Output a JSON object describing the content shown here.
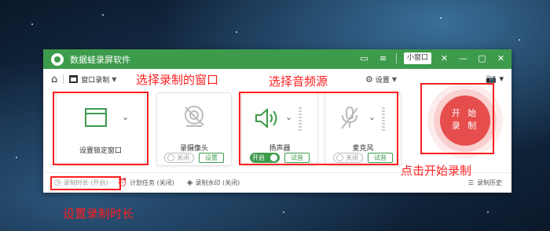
{
  "app": {
    "title": "数据蛙录屏软件",
    "mini_window": "小窗口",
    "icons": [
      "chat-icon",
      "mini-window-button",
      "pin-icon",
      "minimize-icon",
      "maximize-icon",
      "close-icon"
    ]
  },
  "toolbar": {
    "mode_label": "窗口录制",
    "settings_label": "设置"
  },
  "cards": {
    "window": {
      "label": "设置锁定窗口"
    },
    "camera": {
      "label": "录摄像头",
      "toggle": "关闭",
      "button": "设置"
    },
    "speaker": {
      "label": "扬声器",
      "toggle": "开启",
      "button": "试音"
    },
    "mic": {
      "label": "麦克风",
      "toggle": "关闭",
      "button": "试音"
    }
  },
  "record": {
    "line1": "开 始",
    "line2": "录 制"
  },
  "footer": {
    "duration": "录制时长 (开启)",
    "schedule": "计划任务 (关闭)",
    "watermark": "录制水印 (关闭)",
    "history": "录制历史"
  },
  "annotations": {
    "select_window": "选择录制的窗口",
    "select_audio": "选择音频源",
    "start_record": "点击开始录制",
    "set_duration": "设置录制时长"
  },
  "colors": {
    "brand_green": "#3d9b4c",
    "record_red": "#e64d4d",
    "annotation_red": "#ff1e1e"
  }
}
